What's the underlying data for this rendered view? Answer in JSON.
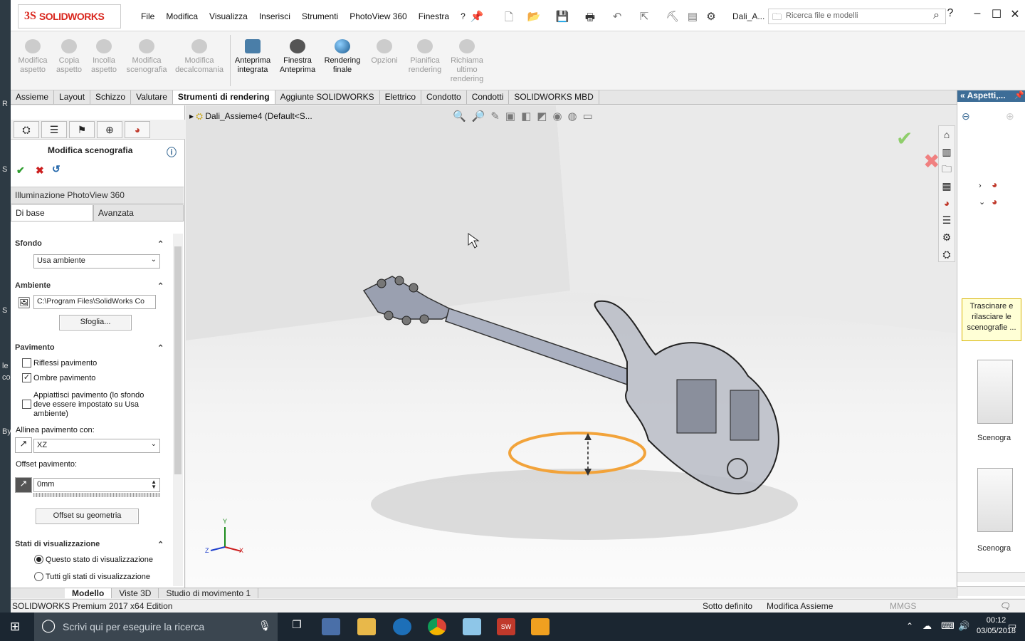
{
  "app": {
    "logo_ds": "3S",
    "logo_name": "SOLIDWORKS",
    "doc_name": "Dali_A...",
    "search_placeholder": "Ricerca file e modelli"
  },
  "menu": [
    "File",
    "Modifica",
    "Visualizza",
    "Inserisci",
    "Strumenti",
    "PhotoView 360",
    "Finestra",
    "?"
  ],
  "ribbon": [
    {
      "label": "Modifica aspetto",
      "enabled": false
    },
    {
      "label": "Copia aspetto",
      "enabled": false
    },
    {
      "label": "Incolla aspetto",
      "enabled": false
    },
    {
      "label": "Modifica scenografia",
      "enabled": false
    },
    {
      "label": "Modifica decalcomania",
      "enabled": false
    },
    {
      "label": "Anteprima integrata",
      "enabled": true
    },
    {
      "label": "Finestra Anteprima",
      "enabled": true
    },
    {
      "label": "Rendering finale",
      "enabled": true
    },
    {
      "label": "Opzioni",
      "enabled": false
    },
    {
      "label": "Pianifica rendering",
      "enabled": false
    },
    {
      "label": "Richiama ultimo rendering",
      "enabled": false
    }
  ],
  "tabs": [
    "Assieme",
    "Layout",
    "Schizzo",
    "Valutare",
    "Strumenti di rendering",
    "Aggiunte SOLIDWORKS",
    "Elettrico",
    "Condotto",
    "Condotti",
    "SOLIDWORKS MBD"
  ],
  "active_tab": "Strumenti di rendering",
  "pm": {
    "title": "Modifica scenografia",
    "section": "Illuminazione PhotoView 360",
    "subtab_basic": "Di base",
    "subtab_adv": "Avanzata",
    "sfondo": {
      "title": "Sfondo",
      "value": "Usa ambiente"
    },
    "ambiente": {
      "title": "Ambiente",
      "path": "C:\\Program Files\\SolidWorks Co",
      "browse": "Sfoglia..."
    },
    "pavimento": {
      "title": "Pavimento",
      "riflessi": "Riflessi pavimento",
      "riflessi_checked": false,
      "ombre": "Ombre pavimento",
      "ombre_checked": true,
      "appiattisci": "Appiattisci pavimento (lo sfondo deve essere impostato su Usa ambiente)",
      "appiattisci_checked": false,
      "allinea_label": "Allinea pavimento con:",
      "allinea_value": "XZ",
      "offset_label": "Offset pavimento:",
      "offset_value": "0mm",
      "offset_btn": "Offset su geometria"
    },
    "stati": {
      "title": "Stati di visualizzazione",
      "opt1": "Questo stato di visualizzazione",
      "opt2": "Tutti gli stati di visualizzazione",
      "selected": 1
    }
  },
  "viewport": {
    "tree_item": "Dali_Assieme4  (Default<S...",
    "axis_x": "X",
    "axis_y": "Y",
    "axis_z": "Z"
  },
  "right_panel": {
    "title": "Aspetti,...",
    "tip": "Trascinare e rilasciare le scenografie ...",
    "item1": "Scenogra",
    "item2": "Scenogra"
  },
  "bottom_tabs": [
    "Modello",
    "Viste 3D",
    "Studio di movimento 1"
  ],
  "status": {
    "edition": "SOLIDWORKS Premium 2017 x64 Edition",
    "state": "Sotto definito",
    "mode": "Modifica Assieme",
    "units": "MMGS"
  },
  "taskbar": {
    "search": "Scrivi qui per eseguire la ricerca",
    "time": "00:12",
    "date": "03/05/2018"
  },
  "desktop_edge": [
    "R",
    "S",
    "le",
    "co",
    "S",
    "By"
  ],
  "colors": {
    "accent": "#3d6d97",
    "brand": "#d9271e",
    "gizmo": "#f2a33a"
  }
}
